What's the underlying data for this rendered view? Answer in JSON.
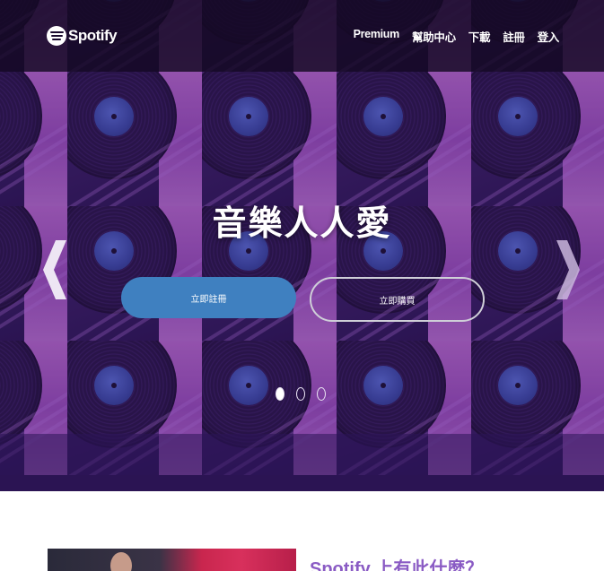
{
  "header": {
    "logo_text": "Spotify",
    "nav": [
      "Premium",
      "幫助中心",
      "下載",
      "註冊",
      "登入"
    ]
  },
  "hero": {
    "title": "音樂人人愛",
    "primary_button": "立即註冊",
    "secondary_button": "立即購買",
    "slides": 3,
    "active_slide": 1
  },
  "section": {
    "title": "Spotify 上有此什麼？"
  },
  "colors": {
    "primary_button": "#3f80c0",
    "section_title": "#8a5bc4",
    "header_bg": "#140822",
    "hero_purple": "#3a1e63",
    "hero_pink": "#c36fd6"
  },
  "icons": {
    "prev": "chevron-left-icon",
    "next": "chevron-right-icon",
    "logo": "spotify-logo-icon"
  }
}
